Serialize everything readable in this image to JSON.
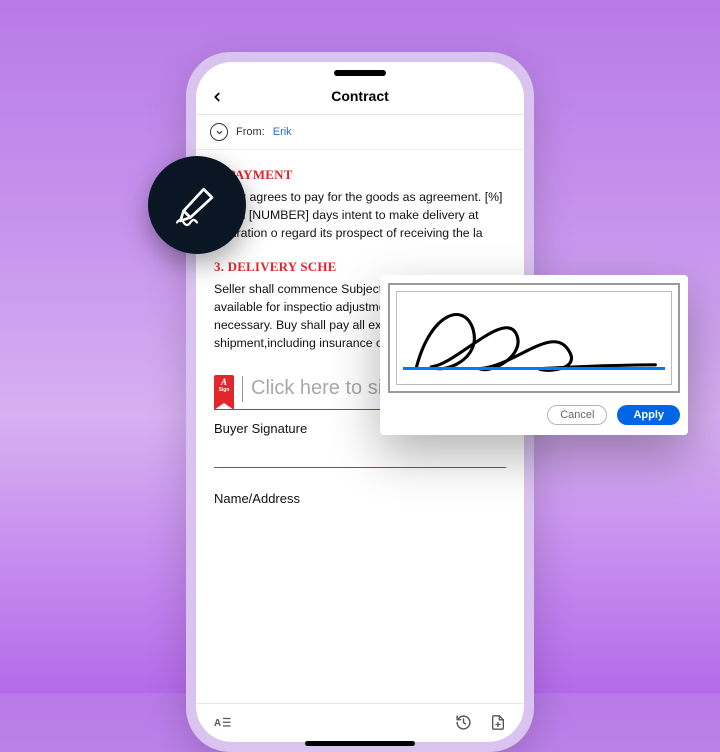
{
  "header": {
    "title": "Contract",
    "from_label": "From:",
    "from_name": "Erik"
  },
  "sections": {
    "payment": {
      "title": "2. PAYMENT",
      "body": "Buyer agrees to pay for the goods as agreement. [%] within [NUMBER] days intent to make delivery at expiration o regard its prospect of receiving the la"
    },
    "delivery": {
      "title": "3. DELIVERY SCHE",
      "body": "Seller shall commence Subject to the provisio available for inspectio adjustments, seller sh as are necessary. Buy shall pay all expenses shipment,including insurance on bot"
    }
  },
  "signature": {
    "tag_top": "A",
    "tag_bottom": "Sign",
    "prompt": "Click here to sign",
    "buyer_label": "Buyer Signature",
    "name_label": "Name/Address"
  },
  "popup": {
    "cancel": "Cancel",
    "apply": "Apply"
  },
  "icons": {
    "pen": "pen-signature-icon",
    "back": "chevron-left-icon",
    "from_toggle": "chevron-down-circle-icon",
    "ae": "text-format-icon",
    "history": "history-icon",
    "page": "page-add-icon"
  }
}
